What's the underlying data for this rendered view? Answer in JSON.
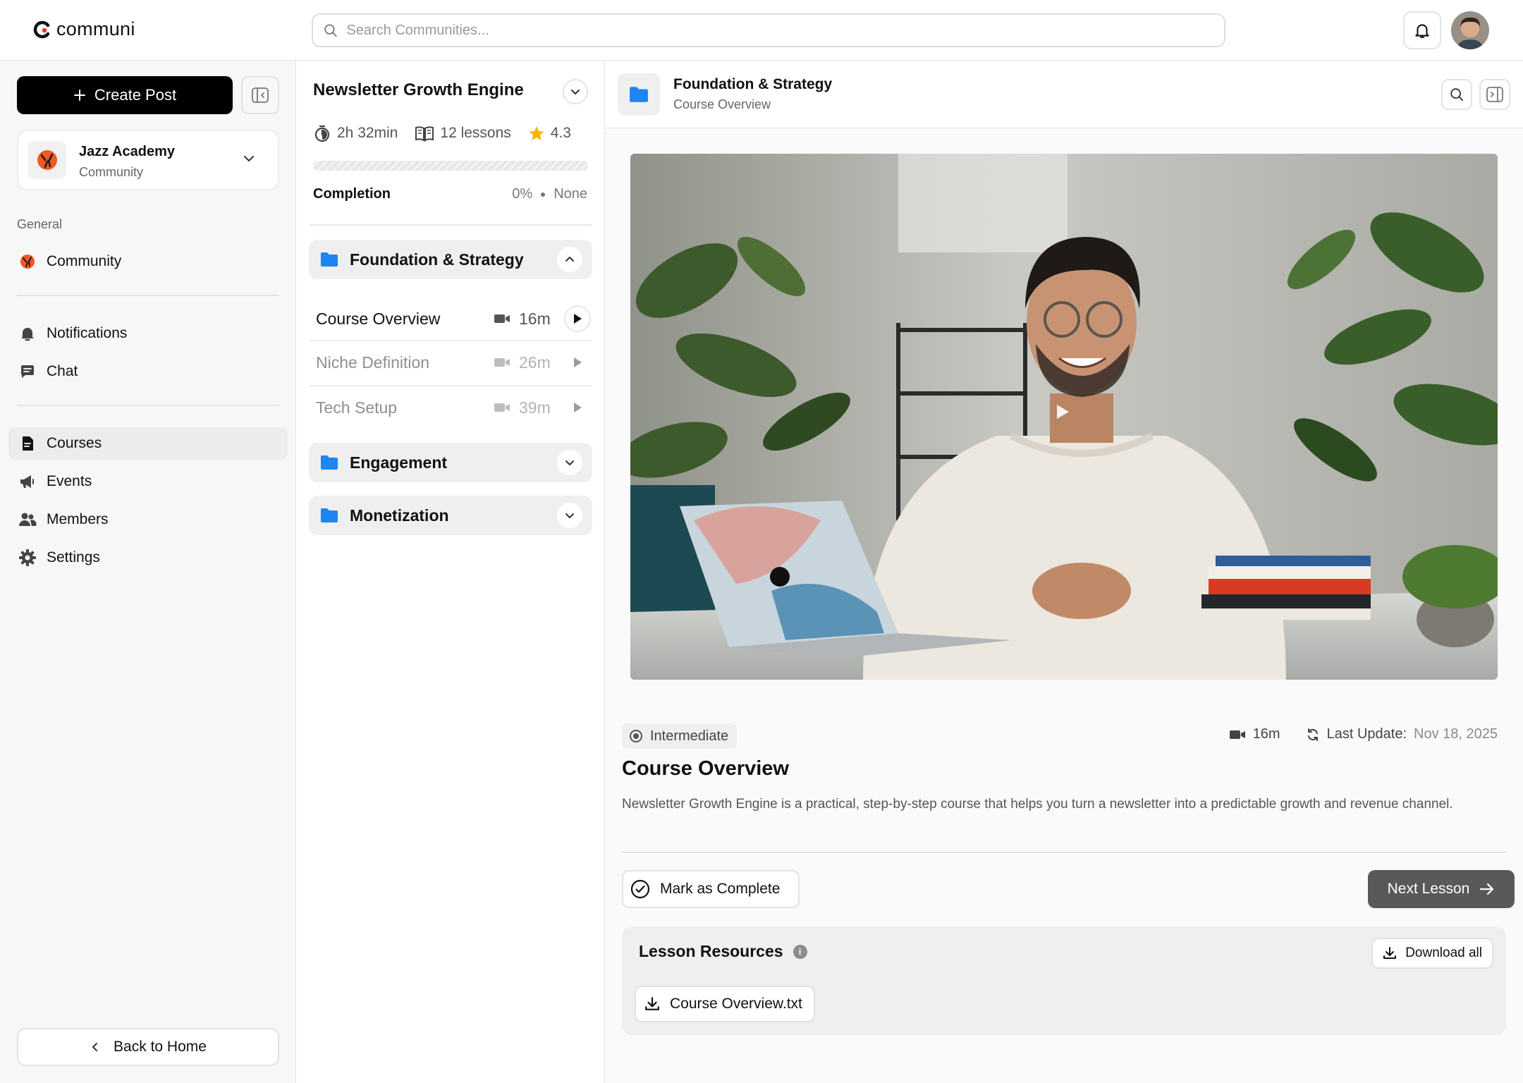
{
  "app": {
    "logo_text": "communi",
    "search_placeholder": "Search Communities..."
  },
  "sidebar": {
    "create_post_label": "Create Post",
    "community": {
      "name": "Jazz Academy",
      "type": "Community"
    },
    "section_general": "General",
    "items": [
      {
        "label": "Community",
        "icon": "community-logo-icon"
      },
      {
        "label": "Notifications",
        "icon": "bell-icon"
      },
      {
        "label": "Chat",
        "icon": "chat-icon"
      },
      {
        "label": "Courses",
        "icon": "document-icon",
        "active": true
      },
      {
        "label": "Events",
        "icon": "megaphone-icon"
      },
      {
        "label": "Members",
        "icon": "users-icon"
      },
      {
        "label": "Settings",
        "icon": "gear-icon"
      }
    ],
    "back_home_label": "Back to Home"
  },
  "course": {
    "title": "Newsletter Growth Engine",
    "duration": "2h 32min",
    "lessons": "12 lessons",
    "rating": "4.3",
    "completion_label": "Completion",
    "completion_percent": "0%",
    "completion_status": "None",
    "progress": 0,
    "modules": [
      {
        "title": "Foundation & Strategy",
        "expanded": true,
        "lessons": [
          {
            "title": "Course Overview",
            "duration": "16m",
            "current": true
          },
          {
            "title": "Niche Definition",
            "duration": "26m"
          },
          {
            "title": "Tech Setup",
            "duration": "39m"
          }
        ]
      },
      {
        "title": "Engagement",
        "expanded": false
      },
      {
        "title": "Monetization",
        "expanded": false
      }
    ]
  },
  "lesson": {
    "module_title": "Foundation & Strategy",
    "title": "Course Overview",
    "level": "Intermediate",
    "duration": "16m",
    "last_update_label": "Last Update:",
    "last_update_date": "Nov 18, 2025",
    "description": "Newsletter Growth Engine is a practical, step-by-step course that helps you turn a newsletter into a predictable growth and revenue channel.",
    "mark_complete_label": "Mark as Complete",
    "next_lesson_label": "Next Lesson",
    "resources_title": "Lesson Resources",
    "download_all_label": "Download all",
    "files": [
      {
        "name": "Course Overview.txt"
      }
    ]
  },
  "colors": {
    "accent_blue": "#1d86f0",
    "star": "#f5b400",
    "next_button": "#595959",
    "primary_button": "#000000"
  }
}
